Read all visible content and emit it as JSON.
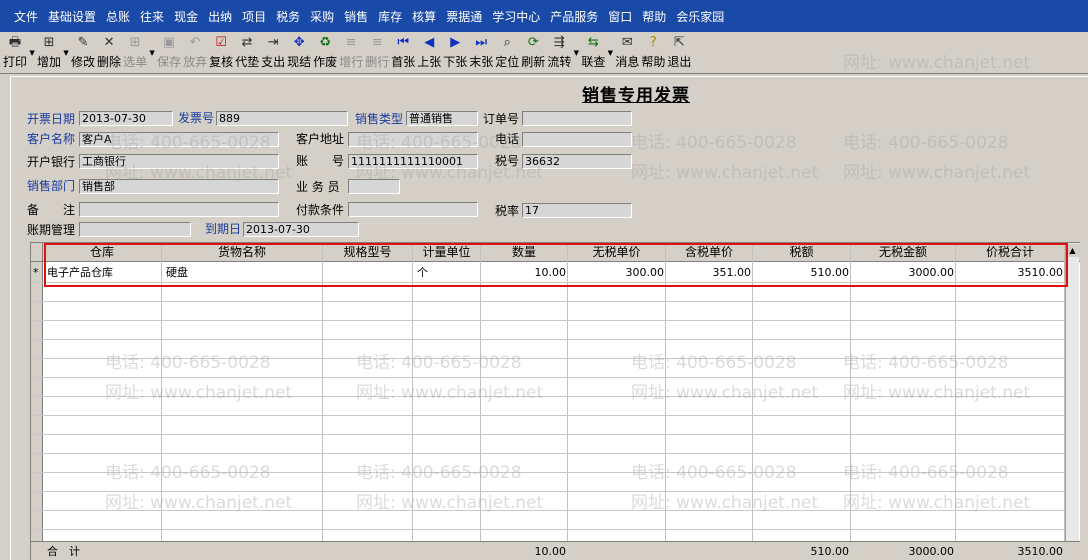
{
  "menu": [
    "文件",
    "基础设置",
    "总账",
    "往来",
    "现金",
    "出纳",
    "项目",
    "税务",
    "采购",
    "销售",
    "库存",
    "核算",
    "票据通",
    "学习中心",
    "产品服务",
    "窗口",
    "帮助",
    "会乐家园"
  ],
  "toolbar": {
    "print": "打印",
    "add": "增加",
    "edit": "修改",
    "delete": "删除",
    "select": "选单",
    "save": "保存",
    "abandon": "放弃",
    "review": "复核",
    "proxy": "代垫",
    "pay": "支出",
    "settle": "现结",
    "void": "作废",
    "add_row": "增行",
    "delete_row": "删行",
    "first": "首张",
    "prev": "上张",
    "next": "下张",
    "last": "末张",
    "locate": "定位",
    "refresh": "刷新",
    "flow": "流转",
    "link": "联查",
    "message": "消息",
    "help": "帮助",
    "exit": "退出"
  },
  "form": {
    "title": "销售专用发票",
    "invoice_date": {
      "label": "开票日期",
      "value": "2013-07-30"
    },
    "invoice_no": {
      "label": "发票号",
      "value": "889"
    },
    "sales_type": {
      "label": "销售类型",
      "value": "普通销售"
    },
    "order_no": {
      "label": "订单号",
      "value": ""
    },
    "customer": {
      "label": "客户名称",
      "value": "客户A"
    },
    "customer_address": {
      "label": "客户地址",
      "value": ""
    },
    "phone": {
      "label": "电话",
      "value": ""
    },
    "bank": {
      "label": "开户银行",
      "value": "工商银行"
    },
    "account": {
      "label": "账　　号",
      "value": "1111111111110001"
    },
    "tax_no": {
      "label": "税号",
      "value": "36632"
    },
    "department": {
      "label": "销售部门",
      "value": "销售部"
    },
    "salesman": {
      "label": "业 务 员",
      "value": ""
    },
    "remark": {
      "label": "备　　注",
      "value": ""
    },
    "payment_terms": {
      "label": "付款条件",
      "value": ""
    },
    "tax_rate": {
      "label": "税率",
      "value": "17"
    },
    "aging": {
      "label": "账期管理",
      "value": ""
    },
    "due_date": {
      "label": "到期日",
      "value": "2013-07-30"
    }
  },
  "grid": {
    "columns": [
      "仓库",
      "货物名称",
      "规格型号",
      "计量单位",
      "数量",
      "无税单价",
      "含税单价",
      "税额",
      "无税金额",
      "价税合计"
    ],
    "rows": [
      {
        "marker": "*",
        "warehouse": "电子产品仓库",
        "item": "硬盘",
        "spec": "",
        "unit": "个",
        "qty": "10.00",
        "unit_price": "300.00",
        "tax_price": "351.00",
        "tax": "510.00",
        "amount": "3000.00",
        "total": "3510.00"
      }
    ],
    "totals": {
      "label": "合　计",
      "qty": "10.00",
      "tax": "510.00",
      "amount": "3000.00",
      "total": "3510.00"
    }
  },
  "watermark": {
    "phone": "电话: 400-665-0028",
    "site": "网址: www.chanjet.net"
  }
}
